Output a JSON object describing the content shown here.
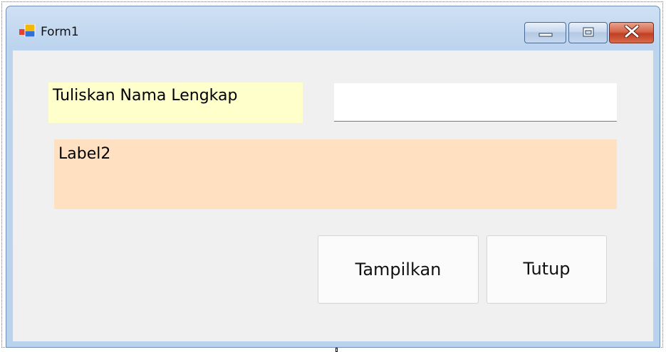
{
  "window": {
    "title": "Form1",
    "icon": "winforms-app-icon",
    "controls": {
      "minimize": "minimize-icon",
      "maximize": "maximize-icon",
      "close": "close-icon"
    }
  },
  "form": {
    "label1_text": "Tuliskan Nama Lengkap",
    "textbox_value": "",
    "label2_text": "Label2",
    "show_button_label": "Tampilkan",
    "close_button_label": "Tutup"
  },
  "colors": {
    "label1_background": "#ffffcc",
    "label2_background": "#ffe0c0",
    "client_background": "#f0f0f0",
    "close_button": "#c13f22"
  }
}
